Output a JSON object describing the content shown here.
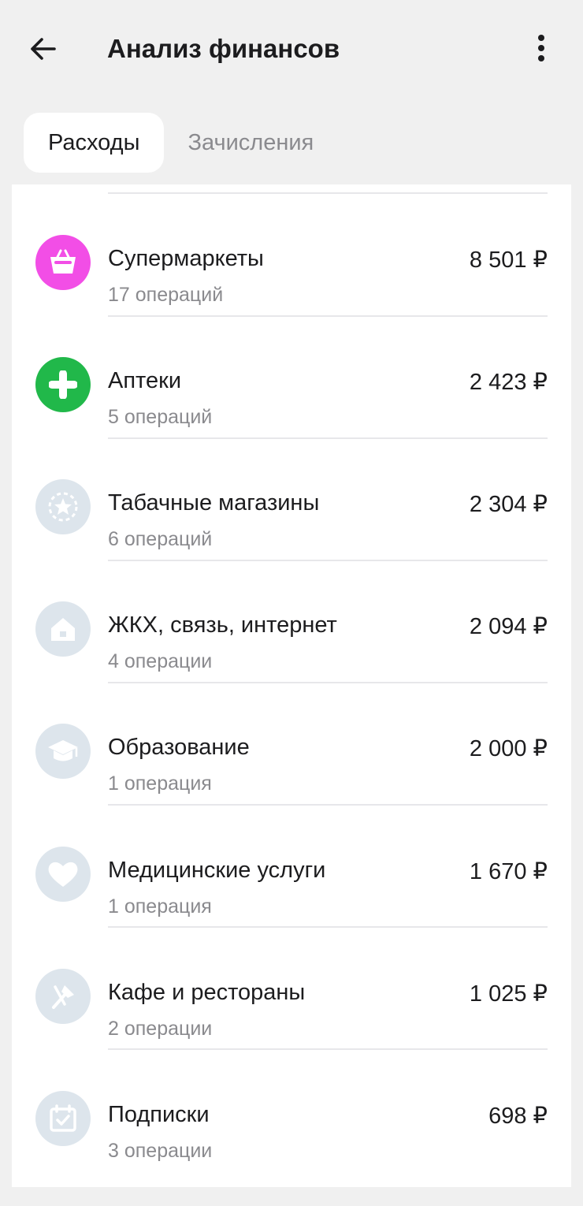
{
  "header": {
    "title": "Анализ финансов",
    "back_icon": "arrow-left-icon",
    "more_icon": "more-vertical-icon"
  },
  "tabs": [
    {
      "label": "Расходы",
      "active": true
    },
    {
      "label": "Зачисления",
      "active": false
    }
  ],
  "colors": {
    "background": "#f0f0f0",
    "card": "#ffffff",
    "primary_text": "#1c1c1e",
    "secondary_text": "#8a8a8e",
    "supermarkets": "#f24ee6",
    "pharmacies": "#21b84a",
    "inactive_icon": "#dde5ec"
  },
  "categories": [
    {
      "name": "Супермаркеты",
      "count": "17 операций",
      "amount": "8 501 ₽",
      "icon": "basket-icon"
    },
    {
      "name": "Аптеки",
      "count": "5 операций",
      "amount": "2 423 ₽",
      "icon": "plus-cross-icon"
    },
    {
      "name": "Табачные магазины",
      "count": "6 операций",
      "amount": "2 304 ₽",
      "icon": "star-icon"
    },
    {
      "name": "ЖКХ, связь, интернет",
      "count": "4 операции",
      "amount": "2 094 ₽",
      "icon": "house-icon"
    },
    {
      "name": "Образование",
      "count": "1 операция",
      "amount": "2 000 ₽",
      "icon": "graduation-cap-icon"
    },
    {
      "name": "Медицинские услуги",
      "count": "1 операция",
      "amount": "1 670 ₽",
      "icon": "heart-icon"
    },
    {
      "name": "Кафе и рестораны",
      "count": "2 операции",
      "amount": "1 025 ₽",
      "icon": "fork-knife-icon"
    },
    {
      "name": "Подписки",
      "count": "3 операции",
      "amount": "698 ₽",
      "icon": "calendar-check-icon"
    }
  ]
}
